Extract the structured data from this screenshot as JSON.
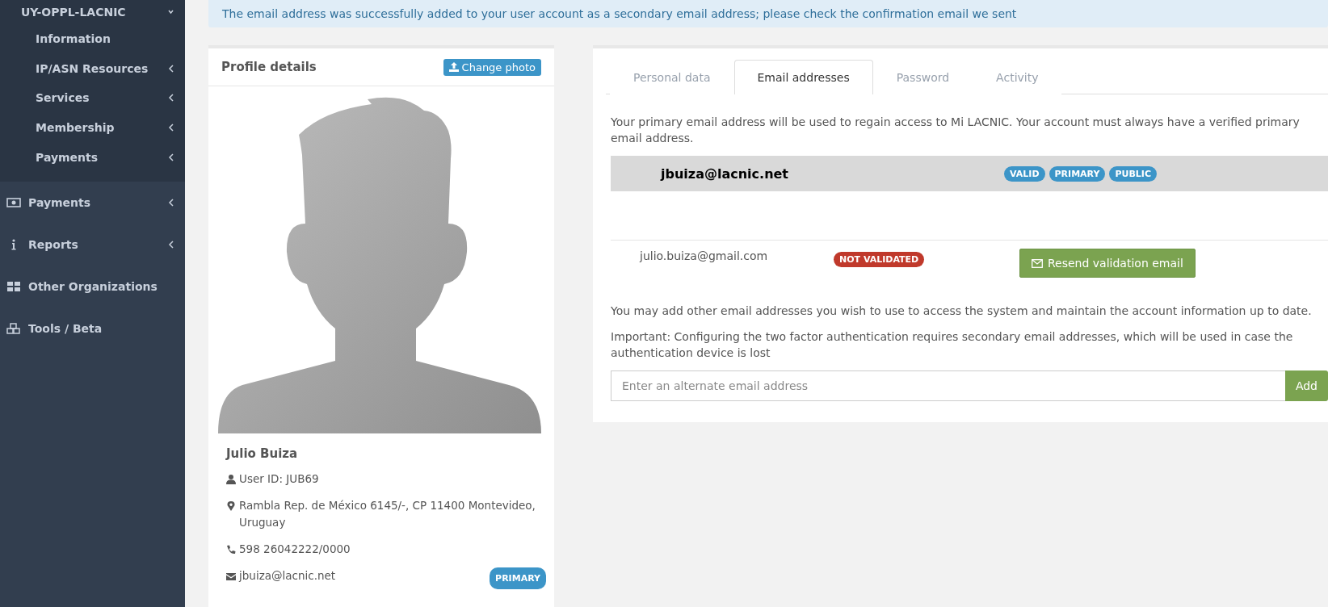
{
  "sidebar": {
    "org": {
      "label": "UY-OPPL-LACNIC",
      "expanded": true
    },
    "sub_items": [
      {
        "label": "Information",
        "has_children": false
      },
      {
        "label": "IP/ASN Resources",
        "has_children": true
      },
      {
        "label": "Services",
        "has_children": true
      },
      {
        "label": "Membership",
        "has_children": true
      },
      {
        "label": "Payments",
        "has_children": true
      }
    ],
    "items": [
      {
        "label": "Payments",
        "kind": "money",
        "has_children": true
      },
      {
        "label": "Reports",
        "kind": "info",
        "has_children": true
      },
      {
        "label": "Other Organizations",
        "kind": "grid",
        "has_children": false
      },
      {
        "label": "Tools / Beta",
        "kind": "cubes",
        "has_children": false
      }
    ]
  },
  "alert": "The email address was successfully added to your user account as a secondary email address; please check the confirmation email we sent",
  "profile": {
    "title": "Profile details",
    "change_photo": "Change photo",
    "name": "Julio Buiza",
    "user_id": "User ID: JUB69",
    "address": "Rambla Rep. de México 6145/-, CP 11400 Montevideo, Uruguay",
    "phone": "598 26042222/0000",
    "email": "jbuiza@lacnic.net",
    "email_badge": {
      "label": "PRIMARY",
      "color": "#3c95c8"
    }
  },
  "tabs": [
    {
      "label": "Personal data",
      "selected": false
    },
    {
      "label": "Email addresses",
      "selected": true
    },
    {
      "label": "Password",
      "selected": false
    },
    {
      "label": "Activity",
      "selected": false
    }
  ],
  "intro": "Your primary email address will be used to regain access to Mi LACNIC. Your account must always have a verified primary email address.",
  "emails": [
    {
      "kind": "primary",
      "address": "jbuiza@lacnic.net",
      "badges": [
        {
          "label": "VALID",
          "color": "#3c95c8"
        },
        {
          "label": "PRIMARY",
          "color": "#3c95c8"
        },
        {
          "label": "PUBLIC",
          "color": "#3c95c8"
        }
      ]
    },
    {
      "kind": "secondary",
      "address": "julio.buiza@gmail.com",
      "badges": [
        {
          "label": "NOT VALIDATED",
          "color": "#c0392b"
        }
      ],
      "action": "Resend validation email"
    }
  ],
  "notes": [
    "You may add other email addresses you wish to use to access the system and maintain the account information up to date.",
    "Important: Configuring the two factor authentication requires secondary email addresses, which will be used in case the authentication device is lost"
  ],
  "add_form": {
    "placeholder": "Enter an alternate email address",
    "button": "Add"
  }
}
